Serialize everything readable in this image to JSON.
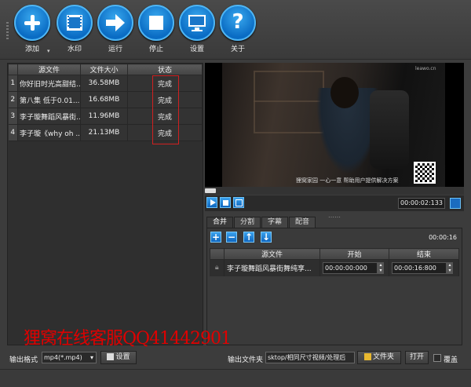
{
  "toolbar": {
    "buttons": [
      {
        "label": "添加",
        "icon": "plus-icon"
      },
      {
        "label": "水印",
        "icon": "film-icon"
      },
      {
        "label": "运行",
        "icon": "arrow-right-icon"
      },
      {
        "label": "停止",
        "icon": "stop-icon"
      },
      {
        "label": "设置",
        "icon": "monitor-icon"
      },
      {
        "label": "关于",
        "icon": "question-icon"
      }
    ]
  },
  "file_table": {
    "headers": [
      "源文件",
      "文件大小",
      "状态"
    ],
    "rows": [
      {
        "idx": "1",
        "name": "你好旧时光高甜结...",
        "size": "36.58MB",
        "status": "完成"
      },
      {
        "idx": "2",
        "name": "第八集 低于0.01...",
        "size": "16.68MB",
        "status": "完成"
      },
      {
        "idx": "3",
        "name": "李子璇舞蹈风暴街...",
        "size": "11.96MB",
        "status": "完成"
      },
      {
        "idx": "4",
        "name": "李子璇《why oh ...",
        "size": "21.13MB",
        "status": "完成"
      }
    ]
  },
  "video": {
    "watermark": "狸窝家园 一心一意 帮助用户提供解决方案",
    "site_logo": "leawo.cn"
  },
  "player": {
    "time": "00:00:02:133"
  },
  "tabs": [
    "合并",
    "分割",
    "字幕",
    "配音"
  ],
  "merge": {
    "duration": "00:00:16",
    "headers": [
      "源文件",
      "开始",
      "结束"
    ],
    "rows": [
      {
        "name": "李子璇舞蹈风暴街舞纯享...",
        "start": "00:00:00:000",
        "end": "00:00:16:800"
      }
    ]
  },
  "overlay_text": "狸窝在线客服QQ41442901",
  "bottom": {
    "format_label": "输出格式",
    "format_value": "mp4(*.mp4)",
    "settings_label": "设置",
    "folder_label": "输出文件夹",
    "folder_path": "sktop/相同尺寸视频/处理后",
    "folder_button": "文件夹",
    "open_button": "打开",
    "overwrite_label": "覆盖"
  },
  "colors": {
    "accent": "#1a8ae0",
    "status_highlight": "#d02020",
    "overlay": "#e00000"
  }
}
